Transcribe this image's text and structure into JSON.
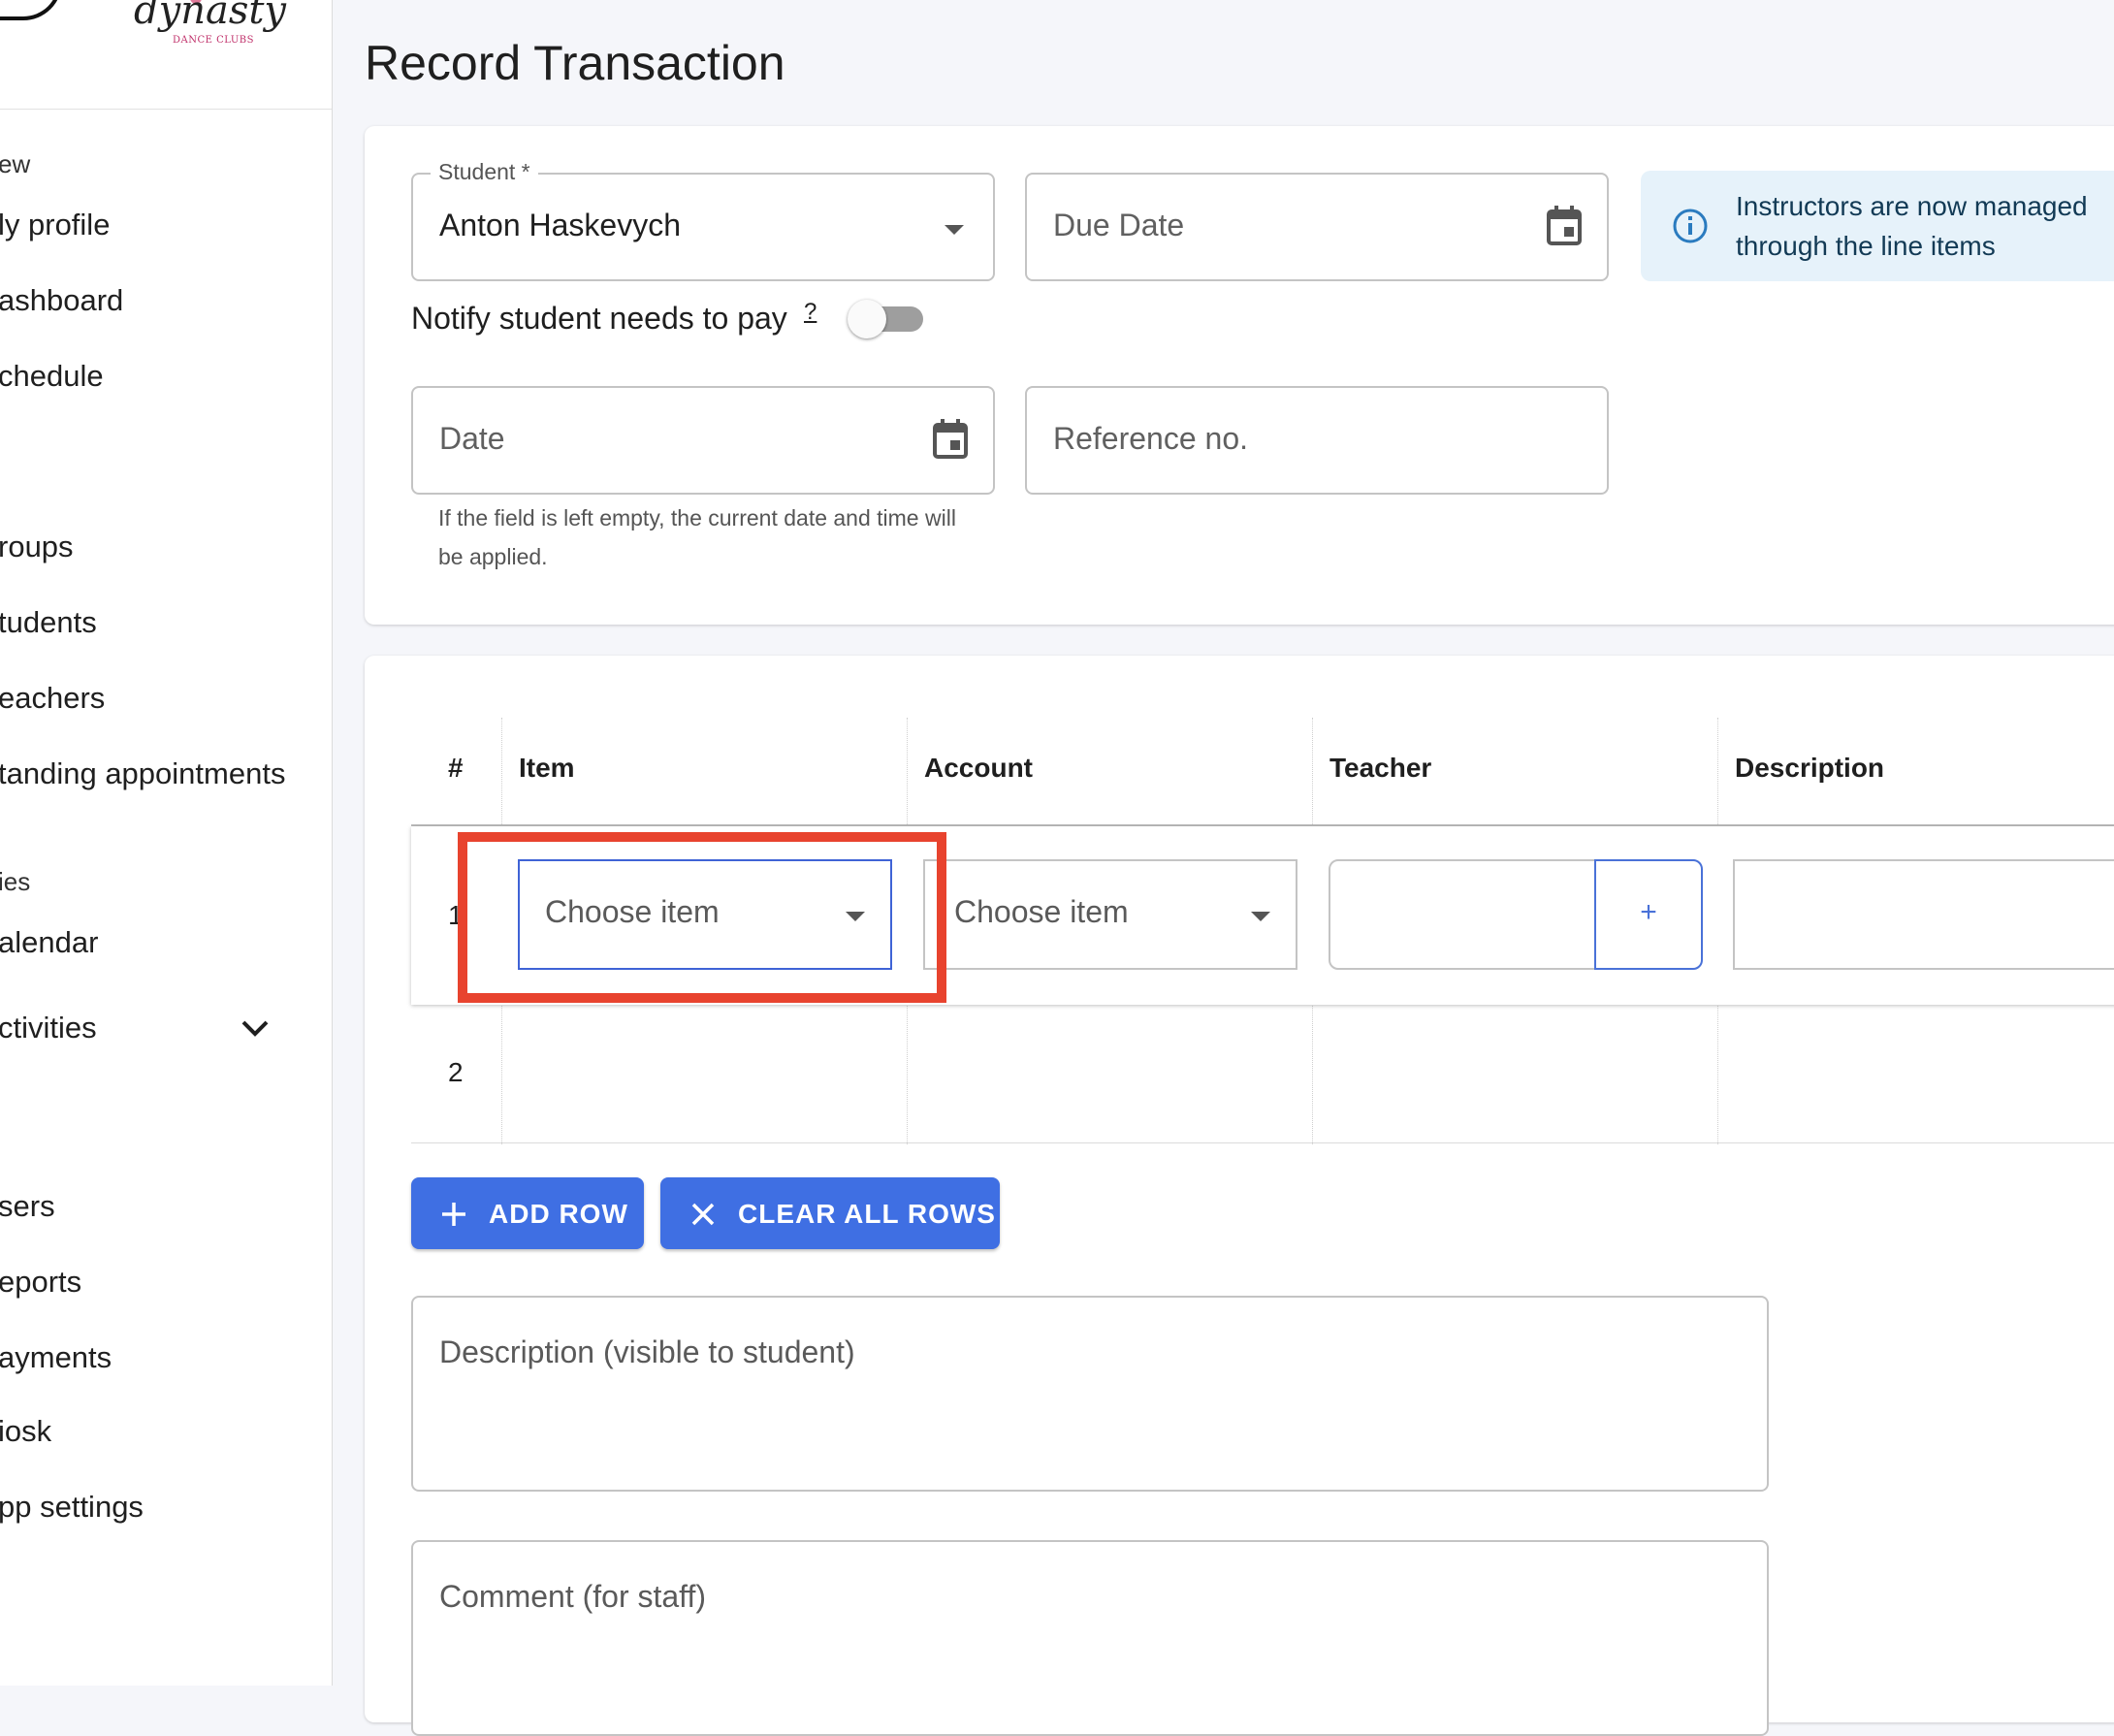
{
  "logo": {
    "text": "dynasty",
    "subtext": "DANCE CLUBS"
  },
  "sidebar": {
    "items": [
      {
        "label": "ew",
        "kind": "section"
      },
      {
        "label": "ly profile"
      },
      {
        "label": "ashboard"
      },
      {
        "label": "chedule"
      },
      {
        "label": "roups"
      },
      {
        "label": "tudents"
      },
      {
        "label": "eachers"
      },
      {
        "label": "tanding appointments"
      },
      {
        "label": "ies",
        "kind": "section"
      },
      {
        "label": "alendar"
      },
      {
        "label": "ctivities"
      },
      {
        "label": "sers"
      },
      {
        "label": "eports"
      },
      {
        "label": "ayments"
      },
      {
        "label": "iosk"
      },
      {
        "label": "pp settings"
      }
    ]
  },
  "page": {
    "title": "Record Transaction"
  },
  "form": {
    "student_label": "Student *",
    "student_value": "Anton Haskevych",
    "due_date_placeholder": "Due Date",
    "notify_label": "Notify student needs to pay",
    "notify_help": "?",
    "notify_enabled": false,
    "date_placeholder": "Date",
    "reference_placeholder": "Reference no.",
    "date_hint": "If the field is left empty, the current date and time will be applied.",
    "info_text": "Instructors are now managed through the line items"
  },
  "table": {
    "headers": [
      "#",
      "Item",
      "Account",
      "Teacher",
      "Description"
    ],
    "rows": [
      {
        "num": "1",
        "item_placeholder": "Choose item",
        "account_placeholder": "Choose item",
        "teacher_add": "+"
      },
      {
        "num": "2"
      }
    ]
  },
  "buttons": {
    "add_row": "ADD ROW",
    "clear_all": "CLEAR ALL ROWS"
  },
  "textareas": {
    "description_placeholder": "Description (visible to student)",
    "comment_placeholder": "Comment (for staff)"
  },
  "colors": {
    "accent": "#3f6fe3",
    "highlight": "#e8432e",
    "info_bg": "#e6f2fa"
  }
}
